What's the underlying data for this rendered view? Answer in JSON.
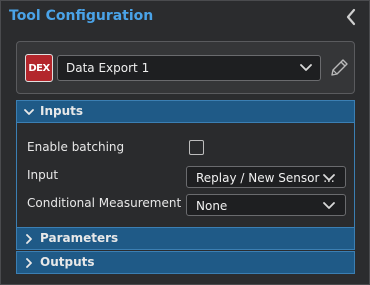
{
  "header": {
    "title": "Tool Configuration"
  },
  "tool": {
    "badge": "DEX",
    "name": "Data Export 1"
  },
  "sections": {
    "inputs": {
      "label": "Inputs",
      "enable_batching_label": "Enable batching",
      "enable_batching_checked": false,
      "input_label": "Input",
      "input_value": "Replay / New Sensor ...",
      "conditional_label": "Conditional Measurement",
      "conditional_value": "None"
    },
    "parameters": {
      "label": "Parameters"
    },
    "outputs": {
      "label": "Outputs"
    }
  },
  "colors": {
    "title": "#4aa3e8",
    "section_header": "#1f5a87",
    "badge": "#b3262c"
  }
}
